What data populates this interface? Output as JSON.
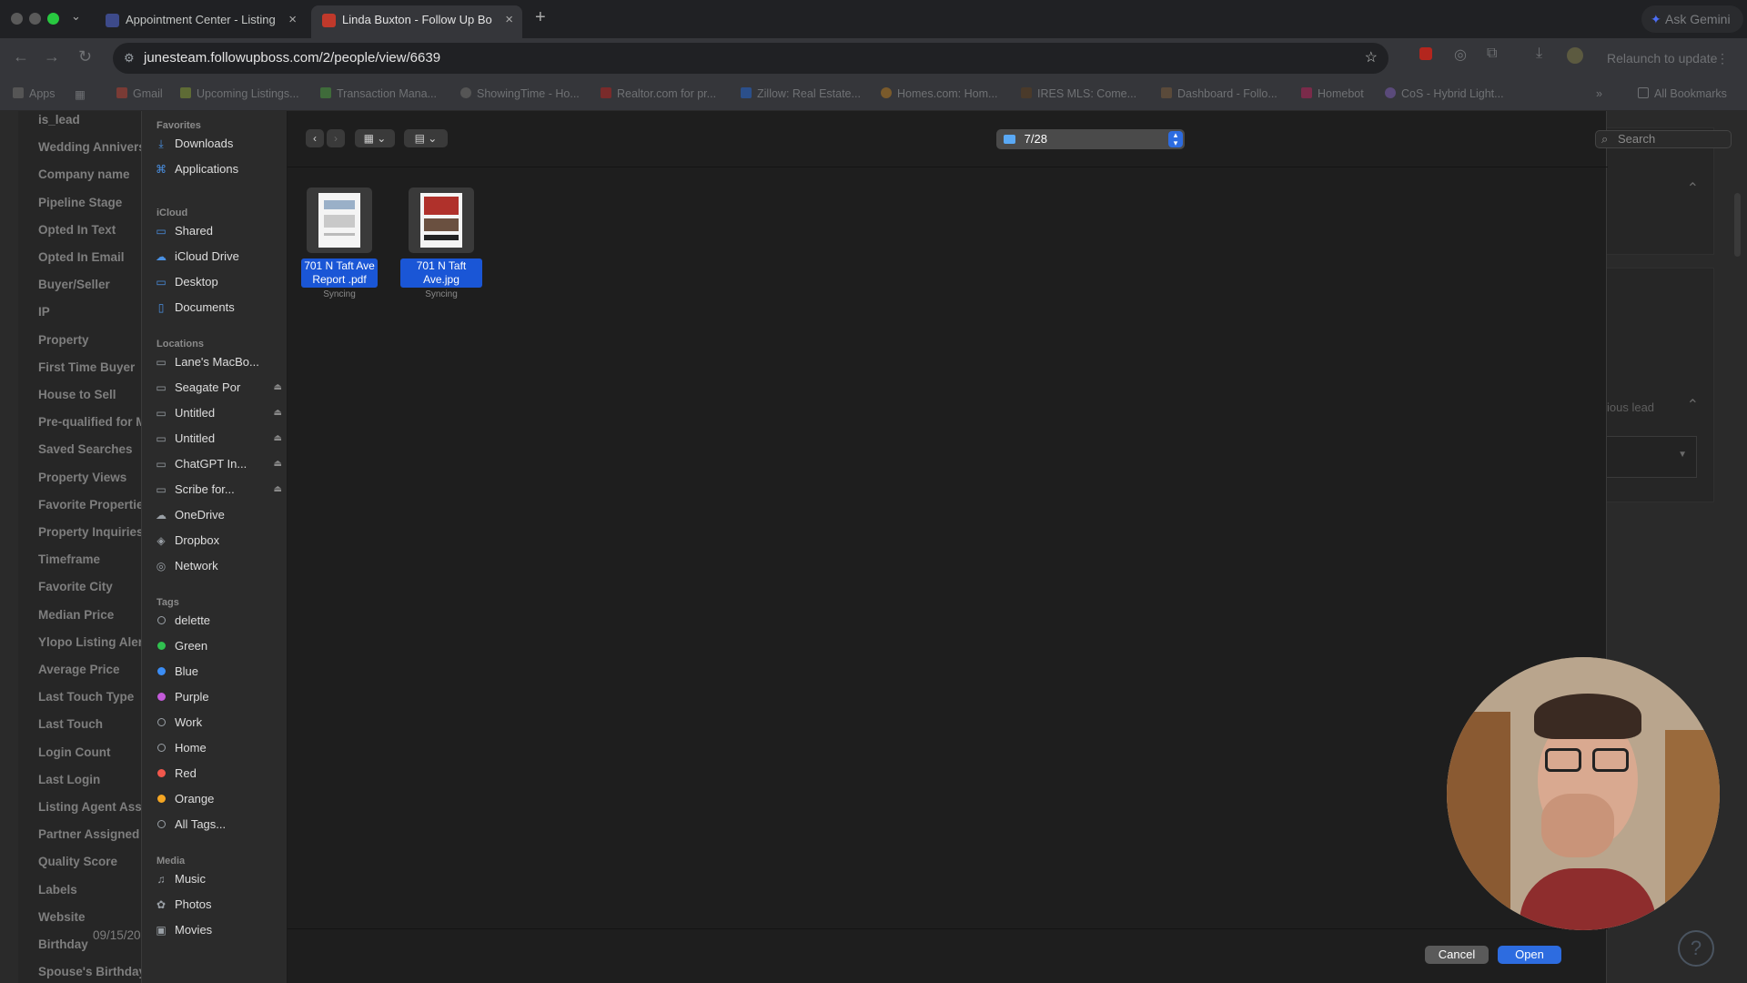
{
  "browser": {
    "tabs": [
      {
        "title": "Appointment Center - Listing",
        "active": false
      },
      {
        "title": "Linda Buxton - Follow Up Bo",
        "active": true
      }
    ],
    "new_tab": "+",
    "url": "junesteam.followupboss.com/2/people/view/6639",
    "ask_gemini": "Ask Gemini",
    "relaunch": "Relaunch to update",
    "bookmarks": [
      "Apps",
      "Gmail",
      "Upcoming Listings...",
      "Transaction Mana...",
      "ShowingTime - Ho...",
      "Realtor.com for pr...",
      "Zillow: Real Estate...",
      "Homes.com: Hom...",
      "IRES MLS: Come...",
      "Dashboard - Follo...",
      "Homebot",
      "CoS - Hybrid Light..."
    ],
    "all_bookmarks": "All Bookmarks"
  },
  "background_page": {
    "fields": [
      "is_lead",
      "Wedding Annivers",
      "Company name",
      "Pipeline Stage",
      "Opted In Text",
      "Opted In Email",
      "Buyer/Seller",
      "IP",
      "Property",
      "First Time Buyer",
      "House to Sell",
      "Pre-qualified for M",
      "Saved Searches",
      "Property Views",
      "Favorite Propertie",
      "Property Inquiries",
      "Timeframe",
      "Favorite City",
      "Median Price",
      "Ylopo Listing Aler",
      "Average Price",
      "Last Touch Type",
      "Last Touch",
      "Login Count",
      "Last Login",
      "Listing Agent Assi",
      "Partner Assigned",
      "Quality Score",
      "Labels",
      "Website",
      "Birthday",
      "Spouse's Birthday"
    ],
    "birthday_value": "09/15/20",
    "right_snippet": "ious lead"
  },
  "dialog": {
    "sidebar": {
      "favorites_header": "Favorites",
      "favorites": [
        {
          "label": "Downloads",
          "icon": "download-icon"
        },
        {
          "label": "Applications",
          "icon": "applications-icon"
        }
      ],
      "icloud_header": "iCloud",
      "icloud": [
        {
          "label": "Shared",
          "icon": "shared-folder-icon"
        },
        {
          "label": "iCloud Drive",
          "icon": "cloud-icon"
        },
        {
          "label": "Desktop",
          "icon": "desktop-icon"
        },
        {
          "label": "Documents",
          "icon": "document-icon"
        }
      ],
      "locations_header": "Locations",
      "locations": [
        {
          "label": "Lane's MacBo...",
          "icon": "laptop-icon",
          "eject": false
        },
        {
          "label": "Seagate Por",
          "icon": "drive-icon",
          "eject": true
        },
        {
          "label": "Untitled",
          "icon": "drive-icon",
          "eject": true
        },
        {
          "label": "Untitled",
          "icon": "drive-icon",
          "eject": true
        },
        {
          "label": "ChatGPT In...",
          "icon": "drive-icon",
          "eject": true
        },
        {
          "label": "Scribe for...",
          "icon": "drive-icon",
          "eject": true
        },
        {
          "label": "OneDrive",
          "icon": "cloud-icon",
          "eject": false
        },
        {
          "label": "Dropbox",
          "icon": "dropbox-icon",
          "eject": false
        },
        {
          "label": "Network",
          "icon": "globe-icon",
          "eject": false
        }
      ],
      "tags_header": "Tags",
      "tags": [
        {
          "label": "delette",
          "color": ""
        },
        {
          "label": "Green",
          "color": "#30c04f"
        },
        {
          "label": "Blue",
          "color": "#3b8df5"
        },
        {
          "label": "Purple",
          "color": "#c35ad9"
        },
        {
          "label": "Work",
          "color": ""
        },
        {
          "label": "Home",
          "color": ""
        },
        {
          "label": "Red",
          "color": "#f1574c"
        },
        {
          "label": "Orange",
          "color": "#f5a623"
        },
        {
          "label": "All Tags...",
          "color": "all"
        }
      ],
      "media_header": "Media",
      "media": [
        {
          "label": "Music",
          "icon": "music-icon"
        },
        {
          "label": "Photos",
          "icon": "photos-icon"
        },
        {
          "label": "Movies",
          "icon": "movies-icon"
        }
      ]
    },
    "folder": "7/28",
    "search_placeholder": "Search",
    "files": [
      {
        "name_line1": "701 N Taft Ave",
        "name_line2": "Report .pdf",
        "status": "Syncing"
      },
      {
        "name_line1": "701 N Taft Ave.jpg",
        "name_line2": "",
        "status": "Syncing"
      }
    ],
    "cancel_label": "Cancel",
    "open_label": "Open"
  },
  "help_label": "?",
  "colors": {
    "accent": "#2d6ce0",
    "selection": "#1a56d6"
  }
}
